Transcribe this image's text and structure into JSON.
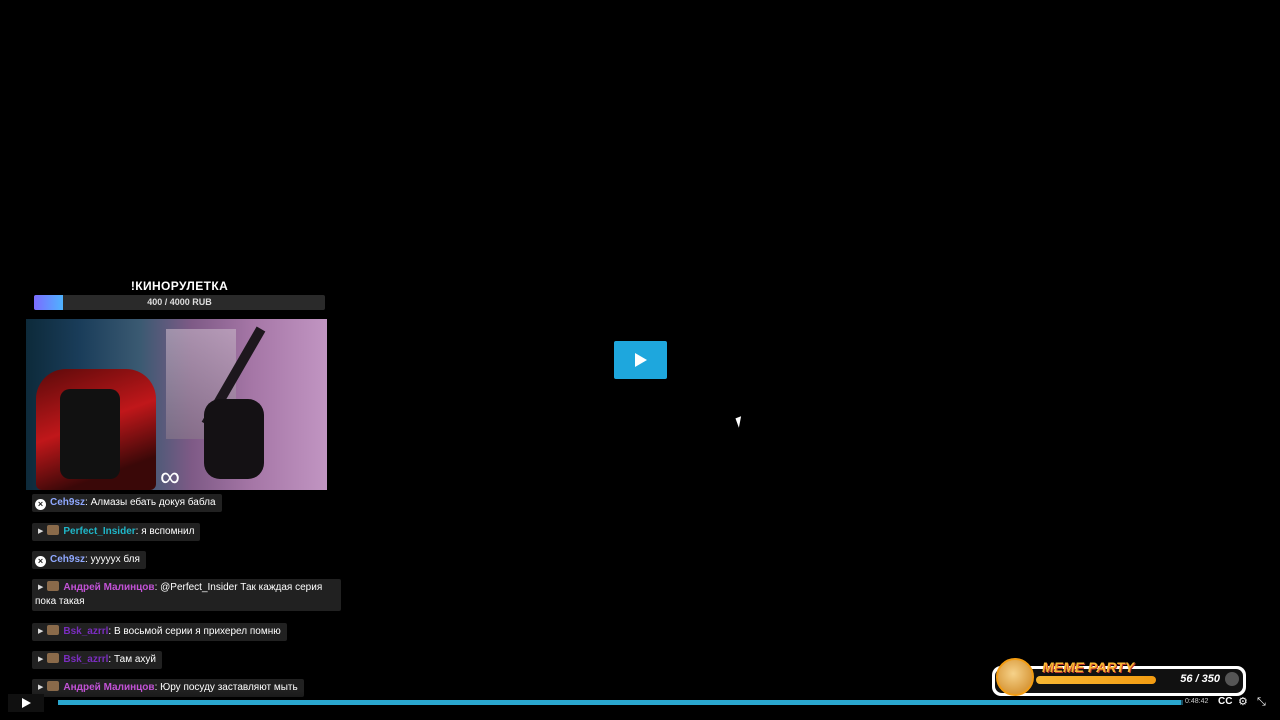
{
  "goal": {
    "title": "!КИНОРУЛЕТКА",
    "progress_text": "400 / 4000 RUB",
    "progress_fraction": 0.1
  },
  "chat": [
    {
      "user": "Ceh9sz",
      "text": "Алмазы ебать докуя бабла",
      "user_color": "#8fa8ff",
      "badge": "x-badge"
    },
    {
      "user": "Perfect_Insider",
      "text": "я вспомнил",
      "user_color": "#1fb6c8",
      "badge": "avatar"
    },
    {
      "user": "Ceh9sz",
      "text": "ууууух бля",
      "user_color": "#8fa8ff",
      "badge": "x-badge"
    },
    {
      "user": "Андрей Малинцов",
      "text": "@Perfect_Insider Так каждая серия пока такая",
      "user_color": "#c252d6",
      "badge": "avatar"
    },
    {
      "user": "Bsk_azrrl",
      "text": "В восьмой серии я прихерел помню",
      "user_color": "#7a2dbf",
      "badge": "avatar"
    },
    {
      "user": "Bsk_azrrl",
      "text": "Там ахуй",
      "user_color": "#7a2dbf",
      "badge": "avatar"
    },
    {
      "user": "Андрей Малинцов",
      "text": "Юру посуду заставляют мыть",
      "user_color": "#c252d6",
      "badge": "avatar"
    }
  ],
  "player": {
    "time": "0:48:42",
    "cc_label": "CC",
    "progress_fraction": 0.998
  },
  "meme_party": {
    "label": "MEME PARTY",
    "count": "56 / 350"
  },
  "icons": {
    "play": "play-icon",
    "settings": "gear-icon",
    "fullscreen": "fullscreen-icon"
  },
  "colors": {
    "accent": "#1ea7dd",
    "progress": "#2aa7cf"
  }
}
